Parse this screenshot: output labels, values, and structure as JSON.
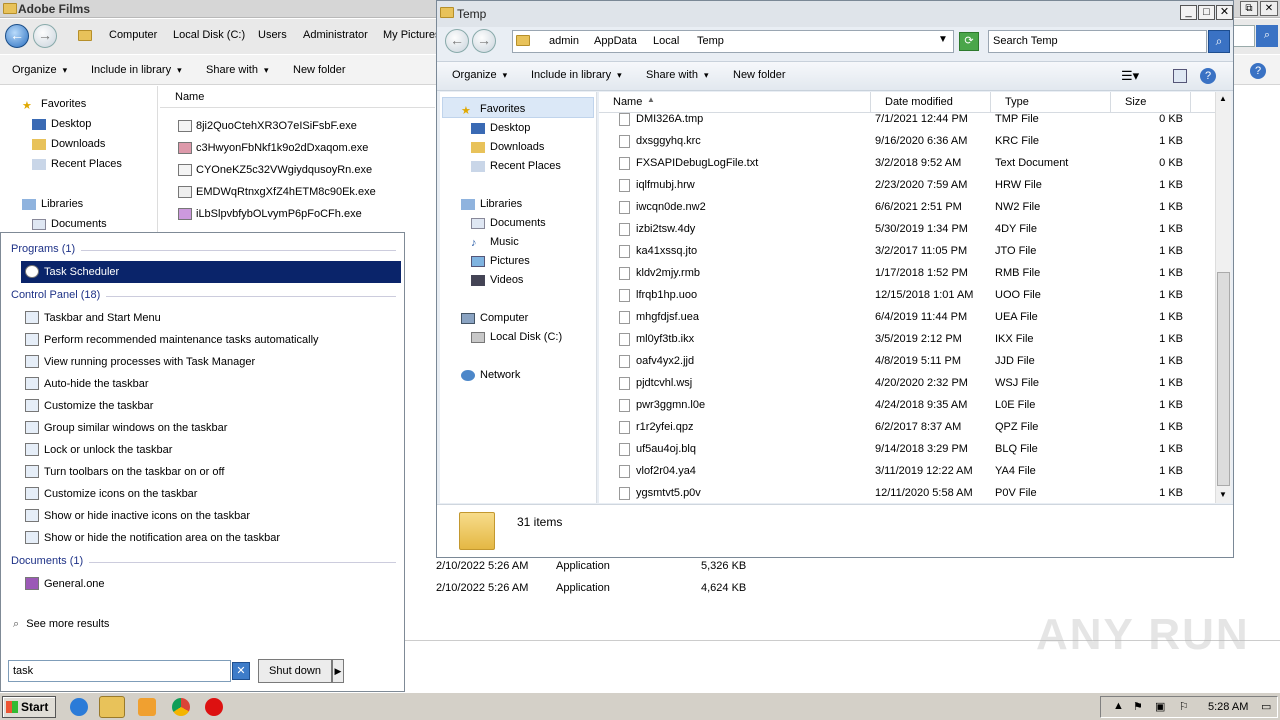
{
  "bg_window": {
    "title": "Adobe Films",
    "breadcrumb": [
      "Computer",
      "Local Disk (C:)",
      "Users",
      "Administrator",
      "My Pictures"
    ],
    "toolbar": [
      "Organize",
      "Include in library",
      "Share with",
      "New folder"
    ],
    "nav": {
      "favorites": "Favorites",
      "desktop": "Desktop",
      "downloads": "Downloads",
      "recent": "Recent Places",
      "libraries": "Libraries",
      "documents": "Documents"
    },
    "col_name": "Name",
    "files": [
      "8ji2QuoCtehXR3O7eISiFsbF.exe",
      "c3HwyonFbNkf1k9o2dDxaqom.exe",
      "CYOneKZ5c32VWgiydqusoyRn.exe",
      "EMDWqRtnxgXfZ4hETM8c90Ek.exe",
      "iLbSlpvbfybOLvymP6pFoCFh.exe"
    ],
    "rows": [
      {
        "date": "2/10/2022 5:26 AM",
        "type": "Application",
        "size": "5,326 KB"
      },
      {
        "date": "2/10/2022 5:26 AM",
        "type": "Application",
        "size": "4,624 KB"
      }
    ]
  },
  "temp_window": {
    "title": "Temp",
    "breadcrumb": [
      "admin",
      "AppData",
      "Local",
      "Temp"
    ],
    "search_placeholder": "Search Temp",
    "toolbar": [
      "Organize",
      "Include in library",
      "Share with",
      "New folder"
    ],
    "nav": {
      "favorites": "Favorites",
      "desktop": "Desktop",
      "downloads": "Downloads",
      "recent": "Recent Places",
      "libraries": "Libraries",
      "documents": "Documents",
      "music": "Music",
      "pictures": "Pictures",
      "videos": "Videos",
      "computer": "Computer",
      "localdisk": "Local Disk (C:)",
      "network": "Network"
    },
    "columns": {
      "name": "Name",
      "date": "Date modified",
      "type": "Type",
      "size": "Size"
    },
    "files": [
      {
        "name": "DMI326A.tmp",
        "date": "7/1/2021 12:44 PM",
        "type": "TMP File",
        "size": "0 KB"
      },
      {
        "name": "dxsggyhq.krc",
        "date": "9/16/2020 6:36 AM",
        "type": "KRC File",
        "size": "1 KB"
      },
      {
        "name": "FXSAPIDebugLogFile.txt",
        "date": "3/2/2018 9:52 AM",
        "type": "Text Document",
        "size": "0 KB"
      },
      {
        "name": "iqlfmubj.hrw",
        "date": "2/23/2020 7:59 AM",
        "type": "HRW File",
        "size": "1 KB"
      },
      {
        "name": "iwcqn0de.nw2",
        "date": "6/6/2021 2:51 PM",
        "type": "NW2 File",
        "size": "1 KB"
      },
      {
        "name": "izbi2tsw.4dy",
        "date": "5/30/2019 1:34 PM",
        "type": "4DY File",
        "size": "1 KB"
      },
      {
        "name": "ka41xssq.jto",
        "date": "3/2/2017 11:05 PM",
        "type": "JTO File",
        "size": "1 KB"
      },
      {
        "name": "kldv2mjy.rmb",
        "date": "1/17/2018 1:52 PM",
        "type": "RMB File",
        "size": "1 KB"
      },
      {
        "name": "lfrqb1hp.uoo",
        "date": "12/15/2018 1:01 AM",
        "type": "UOO File",
        "size": "1 KB"
      },
      {
        "name": "mhgfdjsf.uea",
        "date": "6/4/2019 11:44 PM",
        "type": "UEA File",
        "size": "1 KB"
      },
      {
        "name": "ml0yf3tb.ikx",
        "date": "3/5/2019 2:12 PM",
        "type": "IKX File",
        "size": "1 KB"
      },
      {
        "name": "oafv4yx2.jjd",
        "date": "4/8/2019 5:11 PM",
        "type": "JJD File",
        "size": "1 KB"
      },
      {
        "name": "pjdtcvhl.wsj",
        "date": "4/20/2020 2:32 PM",
        "type": "WSJ File",
        "size": "1 KB"
      },
      {
        "name": "pwr3ggmn.l0e",
        "date": "4/24/2018 9:35 AM",
        "type": "L0E File",
        "size": "1 KB"
      },
      {
        "name": "r1r2yfei.qpz",
        "date": "6/2/2017 8:37 AM",
        "type": "QPZ File",
        "size": "1 KB"
      },
      {
        "name": "uf5au4oj.blq",
        "date": "9/14/2018 3:29 PM",
        "type": "BLQ File",
        "size": "1 KB"
      },
      {
        "name": "vlof2r04.ya4",
        "date": "3/11/2019 12:22 AM",
        "type": "YA4 File",
        "size": "1 KB"
      },
      {
        "name": "ygsmtvt5.p0v",
        "date": "12/11/2020 5:58 AM",
        "type": "P0V File",
        "size": "1 KB"
      }
    ],
    "item_count": "31 items"
  },
  "start_menu": {
    "programs_header": "Programs (1)",
    "programs": [
      "Task Scheduler"
    ],
    "control_header": "Control Panel (18)",
    "control_items": [
      "Taskbar and Start Menu",
      "Perform recommended maintenance tasks automatically",
      "View running processes with Task Manager",
      "Auto-hide the taskbar",
      "Customize the taskbar",
      "Group similar windows on the taskbar",
      "Lock or unlock the taskbar",
      "Turn toolbars on the taskbar on or off",
      "Customize icons on the taskbar",
      "Show or hide inactive icons on the taskbar",
      "Show or hide the notification area on the taskbar"
    ],
    "documents_header": "Documents (1)",
    "documents": [
      "General.one"
    ],
    "see_more": "See more results",
    "search_value": "task",
    "shutdown_label": "Shut down"
  },
  "taskbar": {
    "start_label": "Start",
    "clock": "5:28 AM"
  },
  "watermark": "ANY RUN",
  "colors": {
    "selection": "#0a246a",
    "accent": "#3a72c4"
  }
}
